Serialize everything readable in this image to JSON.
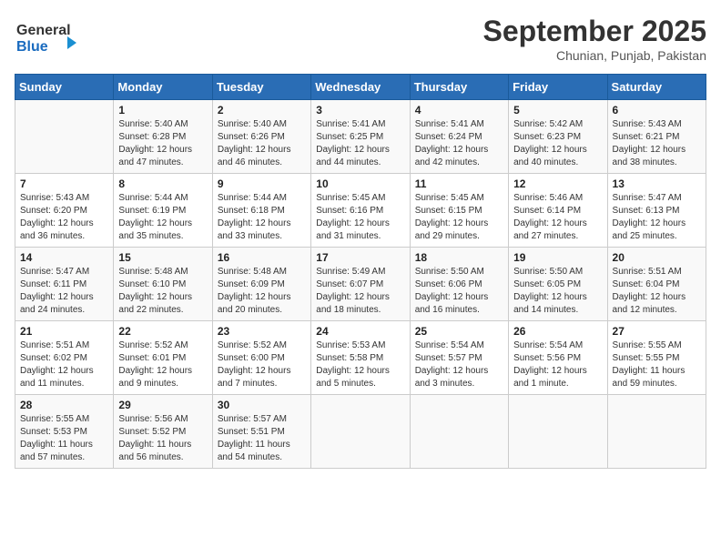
{
  "header": {
    "logo_general": "General",
    "logo_blue": "Blue",
    "month_title": "September 2025",
    "location": "Chunian, Punjab, Pakistan"
  },
  "days_of_week": [
    "Sunday",
    "Monday",
    "Tuesday",
    "Wednesday",
    "Thursday",
    "Friday",
    "Saturday"
  ],
  "weeks": [
    [
      {
        "day": "",
        "sunrise": "",
        "sunset": "",
        "daylight": ""
      },
      {
        "day": "1",
        "sunrise": "5:40 AM",
        "sunset": "6:28 PM",
        "daylight": "12 hours and 47 minutes."
      },
      {
        "day": "2",
        "sunrise": "5:40 AM",
        "sunset": "6:26 PM",
        "daylight": "12 hours and 46 minutes."
      },
      {
        "day": "3",
        "sunrise": "5:41 AM",
        "sunset": "6:25 PM",
        "daylight": "12 hours and 44 minutes."
      },
      {
        "day": "4",
        "sunrise": "5:41 AM",
        "sunset": "6:24 PM",
        "daylight": "12 hours and 42 minutes."
      },
      {
        "day": "5",
        "sunrise": "5:42 AM",
        "sunset": "6:23 PM",
        "daylight": "12 hours and 40 minutes."
      },
      {
        "day": "6",
        "sunrise": "5:43 AM",
        "sunset": "6:21 PM",
        "daylight": "12 hours and 38 minutes."
      }
    ],
    [
      {
        "day": "7",
        "sunrise": "5:43 AM",
        "sunset": "6:20 PM",
        "daylight": "12 hours and 36 minutes."
      },
      {
        "day": "8",
        "sunrise": "5:44 AM",
        "sunset": "6:19 PM",
        "daylight": "12 hours and 35 minutes."
      },
      {
        "day": "9",
        "sunrise": "5:44 AM",
        "sunset": "6:18 PM",
        "daylight": "12 hours and 33 minutes."
      },
      {
        "day": "10",
        "sunrise": "5:45 AM",
        "sunset": "6:16 PM",
        "daylight": "12 hours and 31 minutes."
      },
      {
        "day": "11",
        "sunrise": "5:45 AM",
        "sunset": "6:15 PM",
        "daylight": "12 hours and 29 minutes."
      },
      {
        "day": "12",
        "sunrise": "5:46 AM",
        "sunset": "6:14 PM",
        "daylight": "12 hours and 27 minutes."
      },
      {
        "day": "13",
        "sunrise": "5:47 AM",
        "sunset": "6:13 PM",
        "daylight": "12 hours and 25 minutes."
      }
    ],
    [
      {
        "day": "14",
        "sunrise": "5:47 AM",
        "sunset": "6:11 PM",
        "daylight": "12 hours and 24 minutes."
      },
      {
        "day": "15",
        "sunrise": "5:48 AM",
        "sunset": "6:10 PM",
        "daylight": "12 hours and 22 minutes."
      },
      {
        "day": "16",
        "sunrise": "5:48 AM",
        "sunset": "6:09 PM",
        "daylight": "12 hours and 20 minutes."
      },
      {
        "day": "17",
        "sunrise": "5:49 AM",
        "sunset": "6:07 PM",
        "daylight": "12 hours and 18 minutes."
      },
      {
        "day": "18",
        "sunrise": "5:50 AM",
        "sunset": "6:06 PM",
        "daylight": "12 hours and 16 minutes."
      },
      {
        "day": "19",
        "sunrise": "5:50 AM",
        "sunset": "6:05 PM",
        "daylight": "12 hours and 14 minutes."
      },
      {
        "day": "20",
        "sunrise": "5:51 AM",
        "sunset": "6:04 PM",
        "daylight": "12 hours and 12 minutes."
      }
    ],
    [
      {
        "day": "21",
        "sunrise": "5:51 AM",
        "sunset": "6:02 PM",
        "daylight": "12 hours and 11 minutes."
      },
      {
        "day": "22",
        "sunrise": "5:52 AM",
        "sunset": "6:01 PM",
        "daylight": "12 hours and 9 minutes."
      },
      {
        "day": "23",
        "sunrise": "5:52 AM",
        "sunset": "6:00 PM",
        "daylight": "12 hours and 7 minutes."
      },
      {
        "day": "24",
        "sunrise": "5:53 AM",
        "sunset": "5:58 PM",
        "daylight": "12 hours and 5 minutes."
      },
      {
        "day": "25",
        "sunrise": "5:54 AM",
        "sunset": "5:57 PM",
        "daylight": "12 hours and 3 minutes."
      },
      {
        "day": "26",
        "sunrise": "5:54 AM",
        "sunset": "5:56 PM",
        "daylight": "12 hours and 1 minute."
      },
      {
        "day": "27",
        "sunrise": "5:55 AM",
        "sunset": "5:55 PM",
        "daylight": "11 hours and 59 minutes."
      }
    ],
    [
      {
        "day": "28",
        "sunrise": "5:55 AM",
        "sunset": "5:53 PM",
        "daylight": "11 hours and 57 minutes."
      },
      {
        "day": "29",
        "sunrise": "5:56 AM",
        "sunset": "5:52 PM",
        "daylight": "11 hours and 56 minutes."
      },
      {
        "day": "30",
        "sunrise": "5:57 AM",
        "sunset": "5:51 PM",
        "daylight": "11 hours and 54 minutes."
      },
      {
        "day": "",
        "sunrise": "",
        "sunset": "",
        "daylight": ""
      },
      {
        "day": "",
        "sunrise": "",
        "sunset": "",
        "daylight": ""
      },
      {
        "day": "",
        "sunrise": "",
        "sunset": "",
        "daylight": ""
      },
      {
        "day": "",
        "sunrise": "",
        "sunset": "",
        "daylight": ""
      }
    ]
  ],
  "labels": {
    "sunrise_prefix": "Sunrise: ",
    "sunset_prefix": "Sunset: ",
    "daylight_prefix": "Daylight: "
  }
}
